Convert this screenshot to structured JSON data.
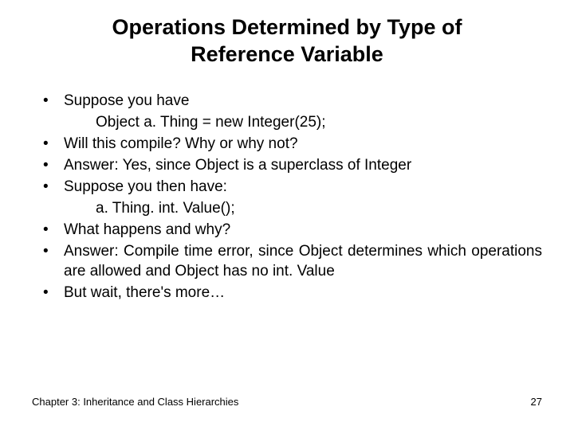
{
  "title_line1": "Operations Determined by Type of",
  "title_line2": "Reference Variable",
  "bullets": {
    "b1": "Suppose you have",
    "b1_code": "Object a. Thing = new Integer(25);",
    "b2": "Will this compile? Why or why not?",
    "b3": "Answer: Yes, since Object is a superclass of Integer",
    "b4": "Suppose you then have:",
    "b4_code": "a. Thing. int. Value();",
    "b5": "What happens and why?",
    "b6": "Answer: Compile time error, since Object determines which operations are allowed and Object has no int. Value",
    "b7": "But wait, there's more…"
  },
  "footer": {
    "chapter": "Chapter 3: Inheritance and Class Hierarchies",
    "page": "27"
  }
}
